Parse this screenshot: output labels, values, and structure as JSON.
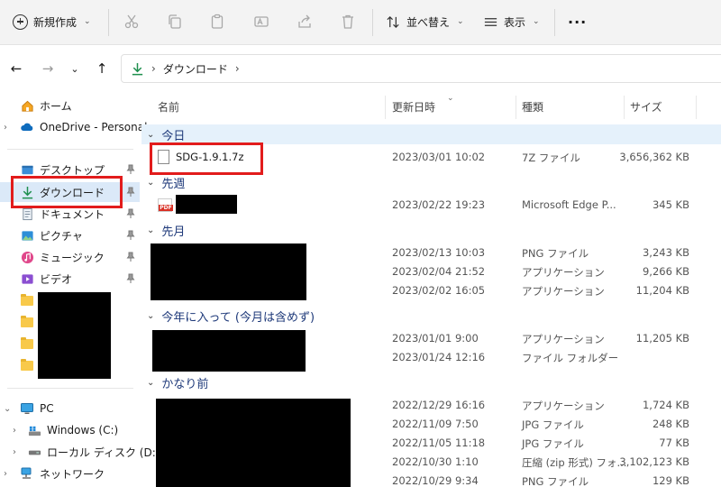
{
  "toolbar": {
    "new_label": "新規作成",
    "sort_label": "並べ替え",
    "view_label": "表示",
    "more_label": "···"
  },
  "address": {
    "folder": "ダウンロード"
  },
  "sidebar": {
    "home": "ホーム",
    "onedrive": "OneDrive - Personal",
    "desktop": "デスクトップ",
    "downloads": "ダウンロード",
    "documents": "ドキュメント",
    "pictures": "ピクチャ",
    "music": "ミュージック",
    "videos": "ビデオ",
    "pc": "PC",
    "windows_c": "Windows (C:)",
    "local_d": "ローカル ディスク (D:)",
    "network": "ネットワーク"
  },
  "columns": {
    "name": "名前",
    "date": "更新日時",
    "type": "種類",
    "size": "サイズ"
  },
  "groups": {
    "today": "今日",
    "last_week": "先週",
    "last_month": "先月",
    "this_year": "今年に入って (今月は含めず)",
    "long_ago": "かなり前"
  },
  "rows": [
    {
      "name": "SDG-1.9.1.7z",
      "date": "2023/03/01 10:02",
      "type": "7Z ファイル",
      "size": "3,656,362 KB"
    },
    {
      "name": "",
      "date": "2023/02/22 19:23",
      "type": "Microsoft Edge P...",
      "size": "345 KB"
    },
    {
      "name": "",
      "date": "2023/02/13 10:03",
      "type": "PNG ファイル",
      "size": "3,243 KB"
    },
    {
      "name": "",
      "date": "2023/02/04 21:52",
      "type": "アプリケーション",
      "size": "9,266 KB"
    },
    {
      "name": "",
      "date": "2023/02/02 16:05",
      "type": "アプリケーション",
      "size": "11,204 KB"
    },
    {
      "name": "",
      "date": "2023/01/01 9:00",
      "type": "アプリケーション",
      "size": "11,205 KB"
    },
    {
      "name": "",
      "date": "2023/01/24 12:16",
      "type": "ファイル フォルダー",
      "size": ""
    },
    {
      "name": "",
      "date": "2022/12/29 16:16",
      "type": "アプリケーション",
      "size": "1,724 KB"
    },
    {
      "name": "",
      "date": "2022/11/09 7:50",
      "type": "JPG ファイル",
      "size": "248 KB"
    },
    {
      "name": "",
      "date": "2022/11/05 11:18",
      "type": "JPG ファイル",
      "size": "77 KB"
    },
    {
      "name": "",
      "date": "2022/10/30 1:10",
      "type": "圧縮 (zip 形式) フォ...",
      "size": "3,102,123 KB"
    },
    {
      "name": "",
      "date": "2022/10/29 9:34",
      "type": "PNG ファイル",
      "size": "129 KB"
    }
  ],
  "pdf_badge": "PDF"
}
